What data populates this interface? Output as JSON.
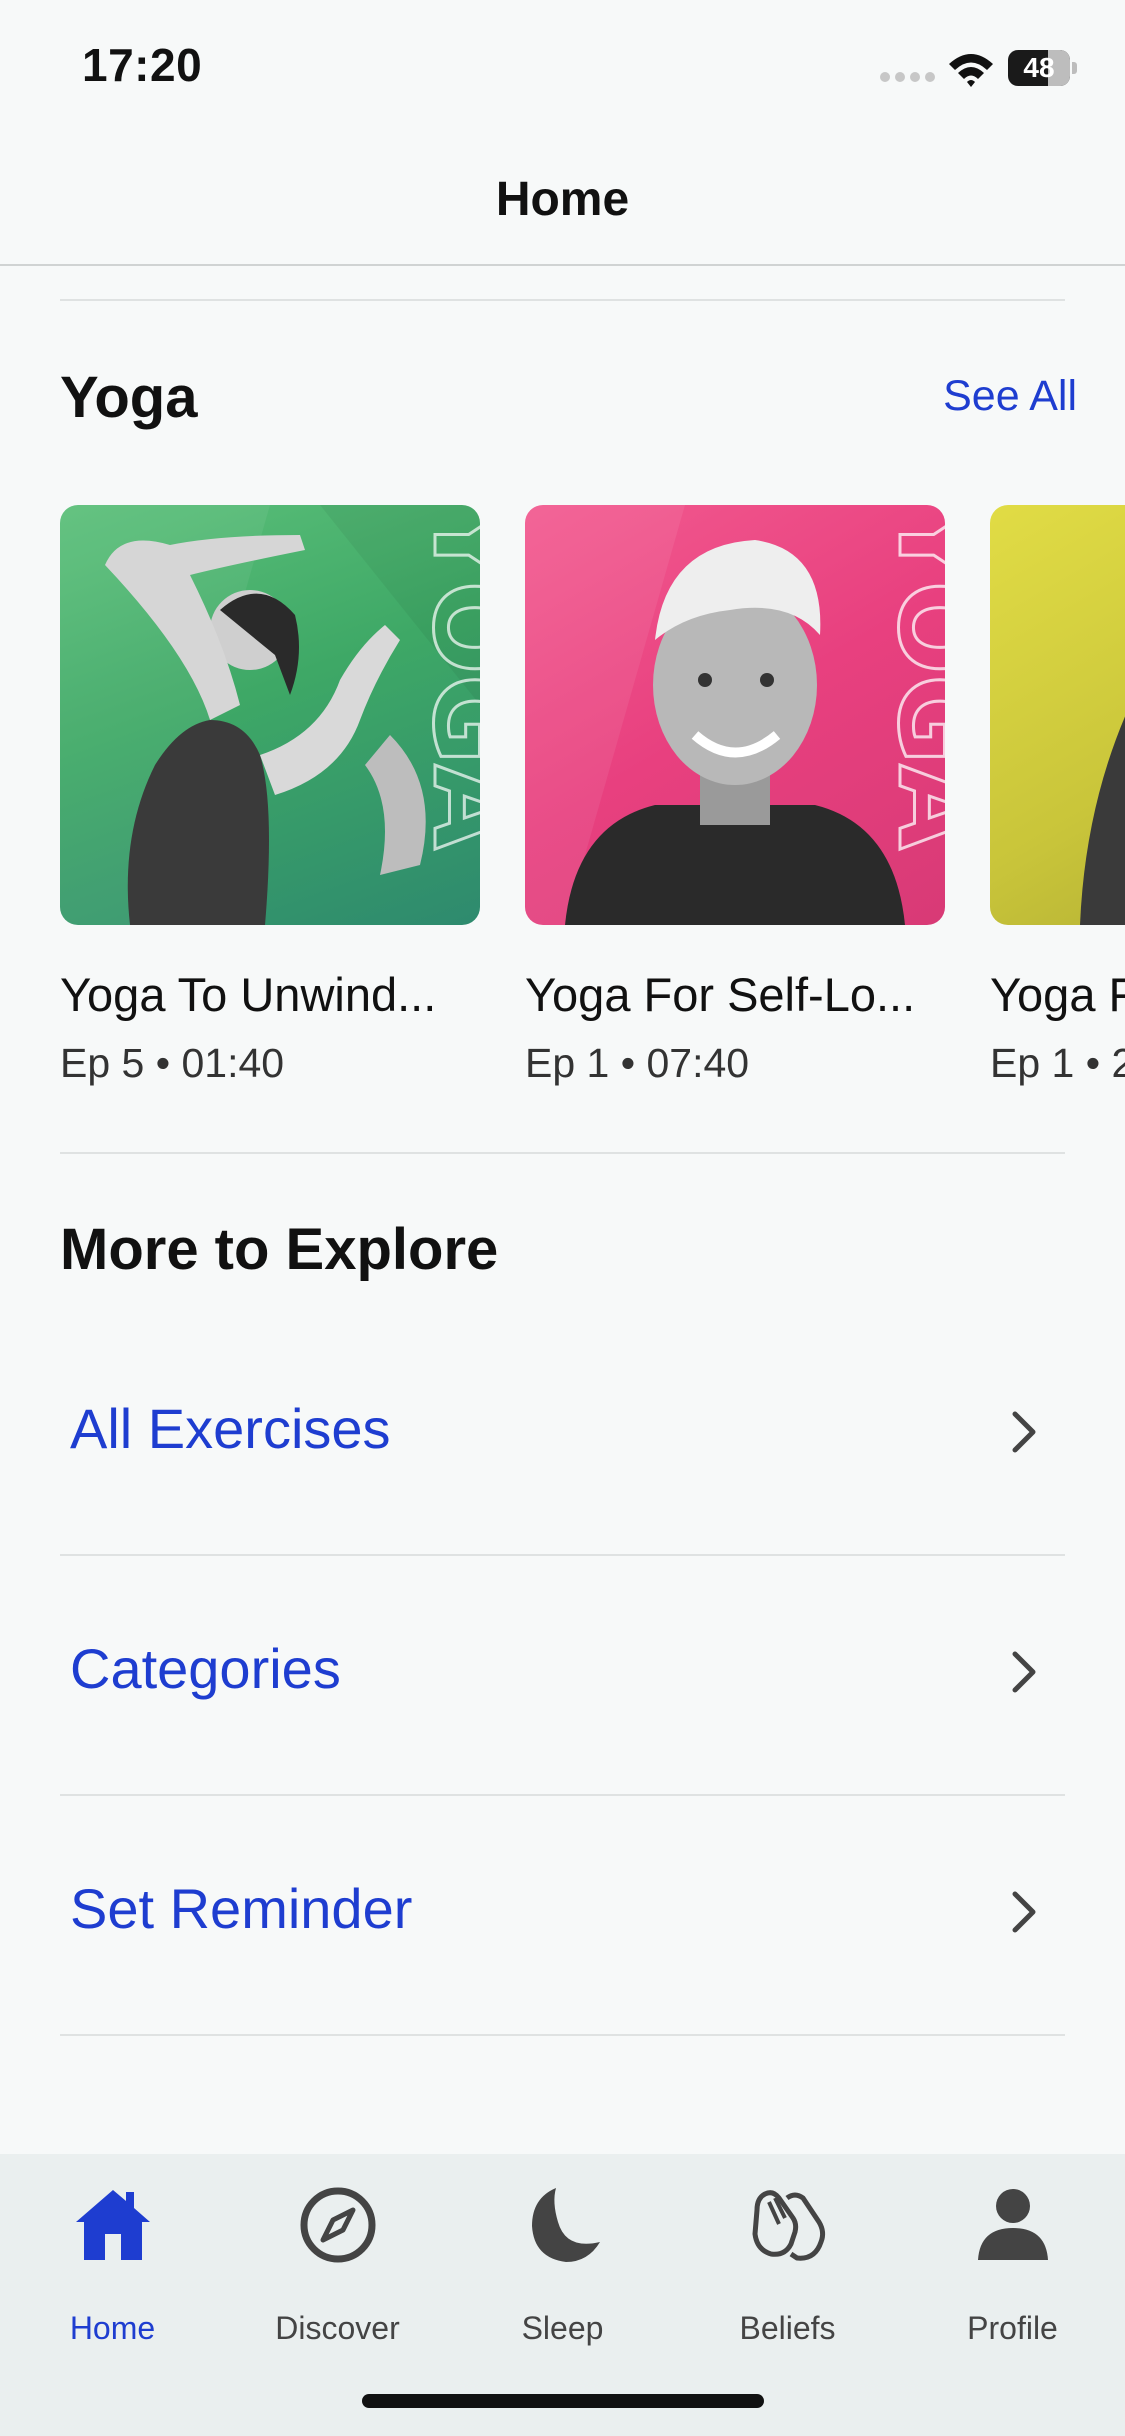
{
  "status_bar": {
    "time": "17:20",
    "battery": "48"
  },
  "header": {
    "title": "Home"
  },
  "yoga": {
    "title": "Yoga",
    "see_all": "See All",
    "cards": [
      {
        "title": "Yoga To Unwind...",
        "meta": "Ep 5 • 01:40",
        "thumb_color": "#3ea866",
        "art_text": "YOGA"
      },
      {
        "title": "Yoga For Self-Lo...",
        "meta": "Ep 1 • 07:40",
        "thumb_color": "#ea4c86",
        "art_text": "YOGA"
      },
      {
        "title": "Yoga F",
        "meta": "Ep 1 • 2",
        "thumb_color": "#c9c53a",
        "art_text": ""
      }
    ]
  },
  "explore": {
    "title": "More to Explore",
    "items": [
      {
        "label": "All Exercises"
      },
      {
        "label": "Categories"
      },
      {
        "label": "Set Reminder"
      }
    ]
  },
  "tab_bar": {
    "tabs": [
      {
        "label": "Home",
        "icon": "home-icon",
        "active": true
      },
      {
        "label": "Discover",
        "icon": "compass-icon",
        "active": false
      },
      {
        "label": "Sleep",
        "icon": "moon-icon",
        "active": false
      },
      {
        "label": "Beliefs",
        "icon": "praying-hands-icon",
        "active": false
      },
      {
        "label": "Profile",
        "icon": "person-icon",
        "active": false
      }
    ]
  },
  "colors": {
    "accent": "#1e3dd0",
    "background": "#f7f9f9",
    "tab_bar_bg": "#eaefef"
  }
}
